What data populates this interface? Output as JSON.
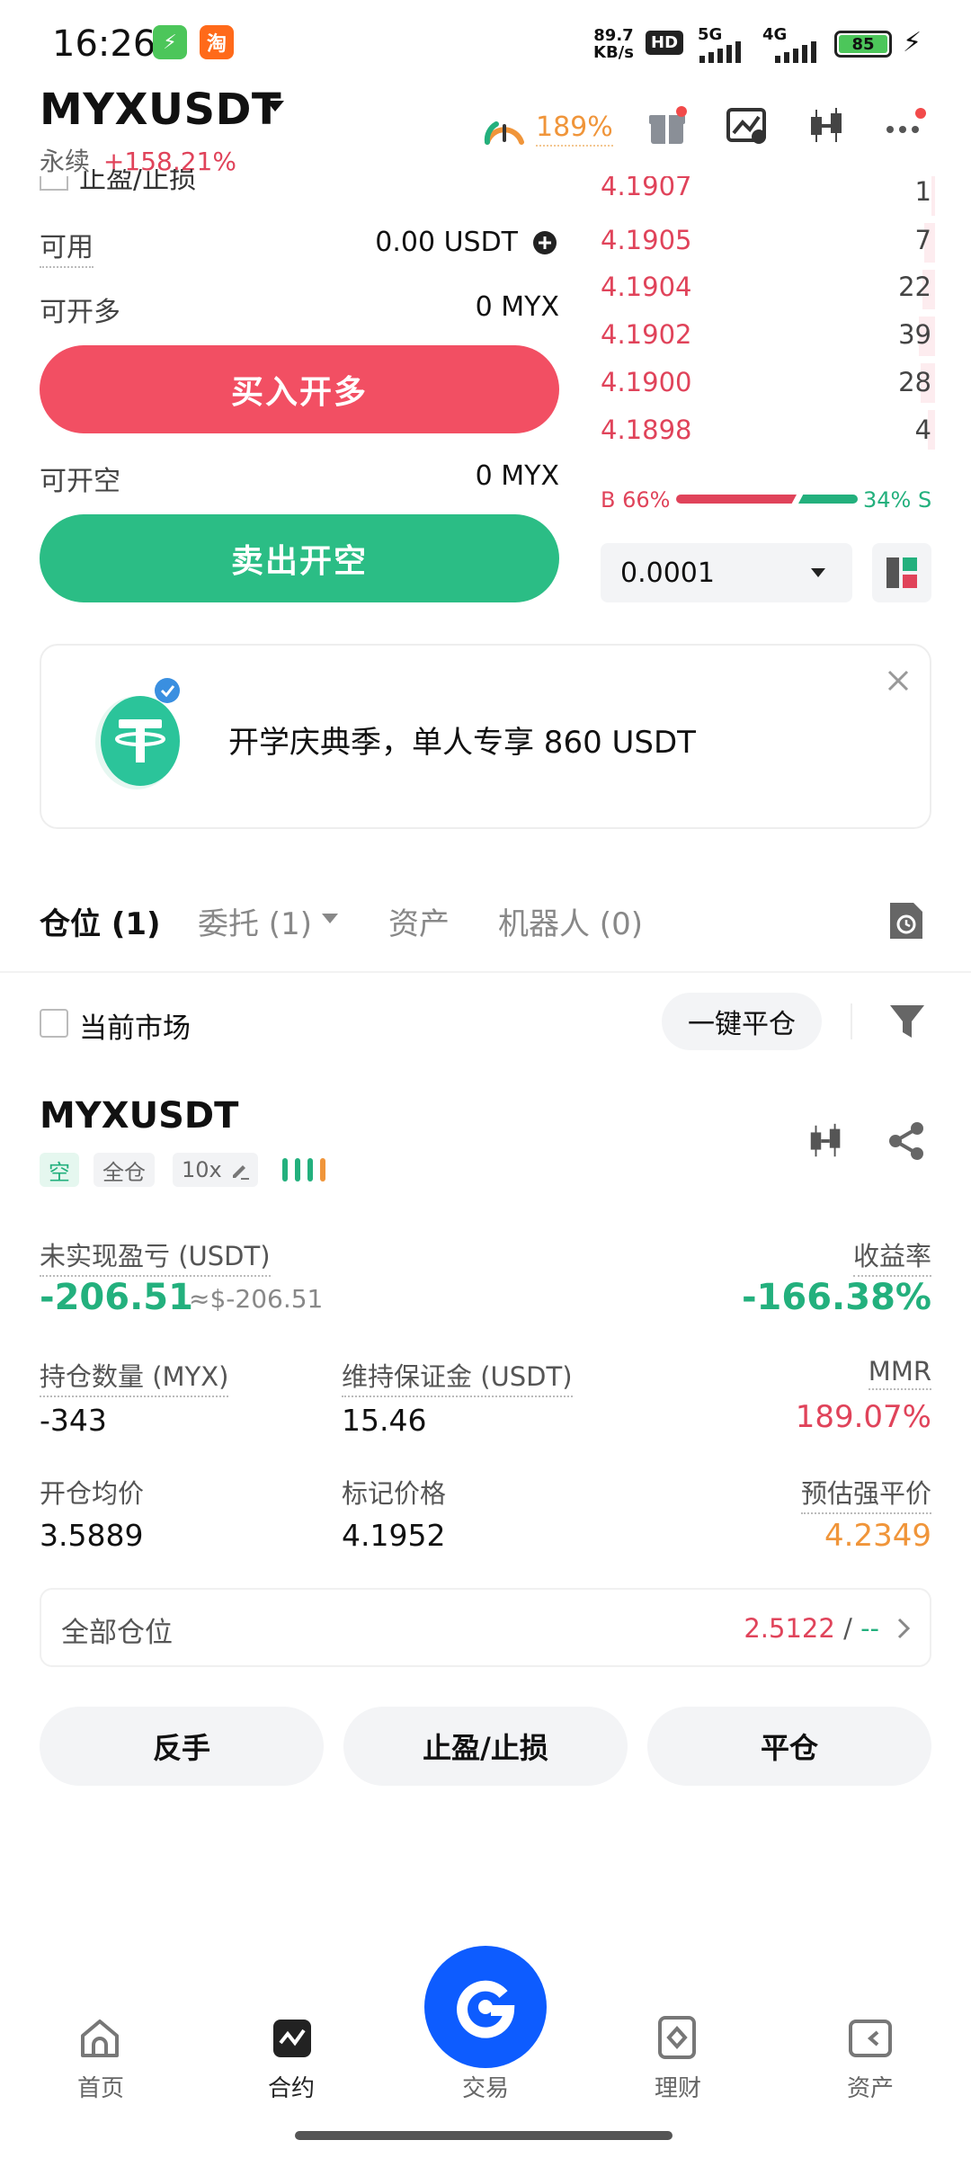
{
  "status_bar": {
    "time": "16:26",
    "net_speed_top": "89.7",
    "net_speed_bottom": "KB/s",
    "hd_label": "HD",
    "net1": "5G",
    "net2": "4G",
    "battery": "85"
  },
  "header": {
    "pair": "MYXUSDT",
    "contract_type": "永续",
    "change_pct": "+158.21%",
    "risk_pct": "189%"
  },
  "order_panel": {
    "partial_label": "止盈/止损",
    "available_label": "可用",
    "available_value": "0.00 USDT",
    "can_long_label": "可开多",
    "can_long_value": "0 MYX",
    "buy_button": "买入开多",
    "can_short_label": "可开空",
    "can_short_value": "0 MYX",
    "sell_button": "卖出开空"
  },
  "order_book": {
    "asks": [
      {
        "price": "4.1907",
        "qty": "1"
      },
      {
        "price": "4.1905",
        "qty": "7"
      },
      {
        "price": "4.1904",
        "qty": "22"
      },
      {
        "price": "4.1902",
        "qty": "39"
      },
      {
        "price": "4.1900",
        "qty": "28"
      },
      {
        "price": "4.1898",
        "qty": "4"
      }
    ],
    "buy_ratio_label": "B 66%",
    "sell_ratio_label": "34% S",
    "buy_ratio": 0.66,
    "precision": "0.0001"
  },
  "banner": {
    "text": "开学庆典季，单人专享 860 USDT",
    "logo_letter": "T"
  },
  "tabs": [
    {
      "label": "仓位 (1)",
      "active": true
    },
    {
      "label": "委托 (1)",
      "active": false
    },
    {
      "label": "资产",
      "active": false
    },
    {
      "label": "机器人 (0)",
      "active": false
    }
  ],
  "filter_row": {
    "current_market_label": "当前市场",
    "close_all_button": "一键平仓"
  },
  "position": {
    "pair": "MYXUSDT",
    "side_tag": "空",
    "margin_tag": "全仓",
    "leverage_tag": "10x",
    "unrealized_label": "未实现盈亏 (USDT)",
    "unrealized_value": "-206.51",
    "unrealized_approx": "≈$-206.51",
    "roe_label": "收益率",
    "roe_value": "-166.38%",
    "size_label": "持仓数量 (MYX)",
    "size_value": "-343",
    "maint_margin_label": "维持保证金 (USDT)",
    "maint_margin_value": "15.46",
    "mmr_label": "MMR",
    "mmr_value": "189.07%",
    "entry_label": "开仓均价",
    "entry_value": "3.5889",
    "mark_label": "标记价格",
    "mark_value": "4.1952",
    "liq_label": "预估强平价",
    "liq_value": "4.2349",
    "all_positions_label": "全部仓位",
    "all_positions_value_red": "2.5122",
    "all_positions_sep": "/",
    "all_positions_value_green": "--"
  },
  "actions": {
    "reverse": "反手",
    "tpsl": "止盈/止损",
    "close": "平仓"
  },
  "bottom_nav": [
    {
      "label": "首页"
    },
    {
      "label": "合约"
    },
    {
      "label": "交易"
    },
    {
      "label": "理财"
    },
    {
      "label": "资产"
    }
  ]
}
